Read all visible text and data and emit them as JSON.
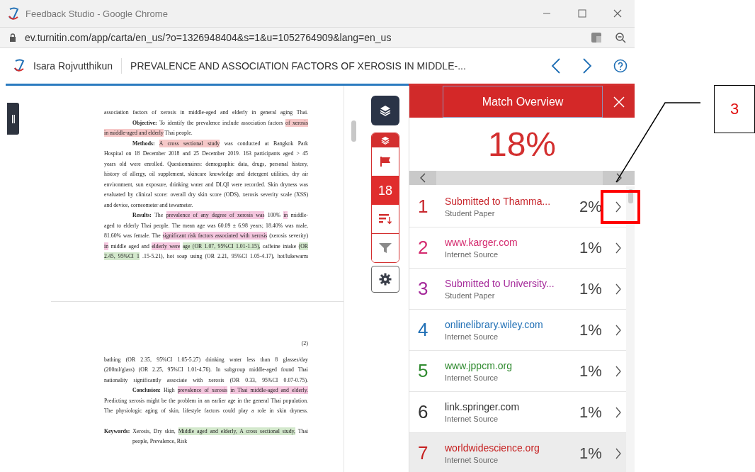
{
  "window": {
    "title": "Feedback Studio - Google Chrome"
  },
  "address_bar": {
    "url": "ev.turnitin.com/app/carta/en_us/?o=1326948404&s=1&u=1052764909&lang=en_us"
  },
  "header": {
    "author": "Isara Rojvutthikun",
    "paper_title": "PREVALENCE AND ASSOCIATION FACTORS OF XEROSIS IN MIDDLE-..."
  },
  "toolbar": {
    "match_count": "18"
  },
  "document": {
    "pages": [
      {
        "lines": [
          {
            "kind": "body",
            "segments": [
              {
                "text": "association factors of xerosis in middle-aged and elderly in general aging Thai."
              }
            ]
          },
          {
            "kind": "first",
            "segments": [
              {
                "text": "**Objective:** To identify the prevalence include association factors"
              },
              {
                "text": "of xerosis",
                "color": "#f6c8c8"
              }
            ]
          },
          {
            "kind": "last",
            "segments": [
              {
                "text": "in middle-aged and elderly",
                "color": "#f6c8c8"
              },
              {
                "text": "Thai people."
              }
            ]
          },
          {
            "kind": "first",
            "segments": [
              {
                "text": "**Methods:**"
              },
              {
                "text": "A cross sectional study",
                "color": "#f6c8c8"
              },
              {
                "text": "was conducted at Bangkok Park"
              }
            ]
          },
          {
            "kind": "body",
            "segments": [
              {
                "text": "Hospital on 18 December 2018 and 25 December 2019. 163 participants aged > 45"
              }
            ]
          },
          {
            "kind": "body",
            "segments": [
              {
                "text": "years old were enrolled. Questionnaires: demographic data, drugs, personal history,"
              }
            ]
          },
          {
            "kind": "body",
            "segments": [
              {
                "text": "history of allergy, oil supplement, skincare knowledge and detergent utilities, dry air"
              }
            ]
          },
          {
            "kind": "body",
            "segments": [
              {
                "text": "environment, sun exposure, drinking water and DLQI were recorded. Skin dryness was"
              }
            ]
          },
          {
            "kind": "body",
            "segments": [
              {
                "text": "evaluated by clinical score: overall dry skin score (ODS), xerosis severity scale (XSS)"
              }
            ]
          },
          {
            "kind": "last",
            "segments": [
              {
                "text": "and device, corneometer and tewameter."
              }
            ]
          },
          {
            "kind": "first",
            "segments": [
              {
                "text": "**Results:** The"
              },
              {
                "text": "prevalence of any degree of xerosis was",
                "color": "#f4c6de"
              },
              {
                "text": "100%"
              },
              {
                "text": "in",
                "color": "#f4c6de"
              },
              {
                "text": "middle-"
              }
            ]
          },
          {
            "kind": "body",
            "segments": [
              {
                "text": "aged to elderly Thai people. The mean age was 60.09 ± 6.98 years; 18.40% was male,"
              }
            ]
          },
          {
            "kind": "body",
            "segments": [
              {
                "text": "81.60% was female. The"
              },
              {
                "text": "significant risk factors associated with xerosis",
                "color": "#f4c6de"
              },
              {
                "text": "(xerosis severity)"
              }
            ]
          },
          {
            "kind": "body",
            "segments": [
              {
                "text": "in",
                "color": "#f4c6de"
              },
              {
                "text": "middle aged and"
              },
              {
                "text": "elderly were",
                "color": "#f4c6de"
              },
              {
                "text": "age (OR 1.07, 95%CI 1.01-1.15),",
                "color": "#d3e8cc"
              },
              {
                "text": "caffeine intake"
              },
              {
                "text": "(OR",
                "color": "#d3e8cc"
              }
            ]
          },
          {
            "kind": "body",
            "segments": [
              {
                "text": "2.45, 95%CI 1",
                "color": "#d3e8cc"
              },
              {
                "text": ".15-5.21), hot soap using (OR 2.21, 95%CI 1.05-4.17), hot/lukewarm"
              }
            ]
          }
        ]
      },
      {
        "page_number": "(2)",
        "lines": [
          {
            "kind": "body",
            "segments": [
              {
                "text": "bathing (OR 2.35, 95%CI 1.05-5.27) drinking water less than 8 glasses/day"
              }
            ]
          },
          {
            "kind": "body",
            "segments": [
              {
                "text": "(200ml/glass) (OR 2.25, 95%CI 1.01-4.76). In subgroup middle-aged found Thai"
              }
            ]
          },
          {
            "kind": "body",
            "segments": [
              {
                "text": "nationality significantly associate with xerosis (OR 0.33, 95%CI 0.07-0.75)."
              }
            ]
          },
          {
            "kind": "first",
            "segments": [
              {
                "text": "**Conclusion:** High"
              },
              {
                "text": "prevalence of xerosis",
                "color": "#f4c6de"
              },
              {
                "text": "in Thai middle-aged and elderly.",
                "color": "#f4c6de"
              }
            ]
          },
          {
            "kind": "body",
            "segments": [
              {
                "text": "Predicting xerosis might be the problem in an earlier age in the general Thai population."
              }
            ]
          },
          {
            "kind": "body",
            "segments": [
              {
                "text": "The physiologic aging of skin, lifestyle factors could play a role in skin dryness."
              }
            ]
          },
          {
            "kind": "spaced",
            "segments": [
              {
                "text": "**Keywords:** Xerosis, Dry skin,"
              },
              {
                "text": "Middle aged and elderly, A cross sectional study,",
                "color": "#d3e8cc"
              },
              {
                "text": "Thai"
              }
            ]
          },
          {
            "kind": "hanging",
            "segments": [
              {
                "text": "people, Prevalence, Risk"
              }
            ]
          }
        ]
      }
    ]
  },
  "match_overview": {
    "title": "Match Overview",
    "score": "18%",
    "sources": [
      {
        "number": "1",
        "name": "Submitted to Thamma...",
        "type": "Student Paper",
        "percent": "2%",
        "color": "#c8282e",
        "selected": false
      },
      {
        "number": "2",
        "name": "www.karger.com",
        "type": "Internet Source",
        "percent": "1%",
        "color": "#d42a6e",
        "selected": false
      },
      {
        "number": "3",
        "name": "Submitted to University...",
        "type": "Student Paper",
        "percent": "1%",
        "color": "#a52a9a",
        "selected": false
      },
      {
        "number": "4",
        "name": "onlinelibrary.wiley.com",
        "type": "Internet Source",
        "percent": "1%",
        "color": "#1f6fb5",
        "selected": false
      },
      {
        "number": "5",
        "name": "www.jppcm.org",
        "type": "Internet Source",
        "percent": "1%",
        "color": "#2f8a2f",
        "selected": false
      },
      {
        "number": "6",
        "name": "link.springer.com",
        "type": "Internet Source",
        "percent": "1%",
        "color": "#333333",
        "selected": false
      },
      {
        "number": "7",
        "name": "worldwidescience.org",
        "type": "Internet Source",
        "percent": "1%",
        "color": "#c62020",
        "selected": true
      }
    ]
  },
  "annotation": {
    "label": "3"
  }
}
